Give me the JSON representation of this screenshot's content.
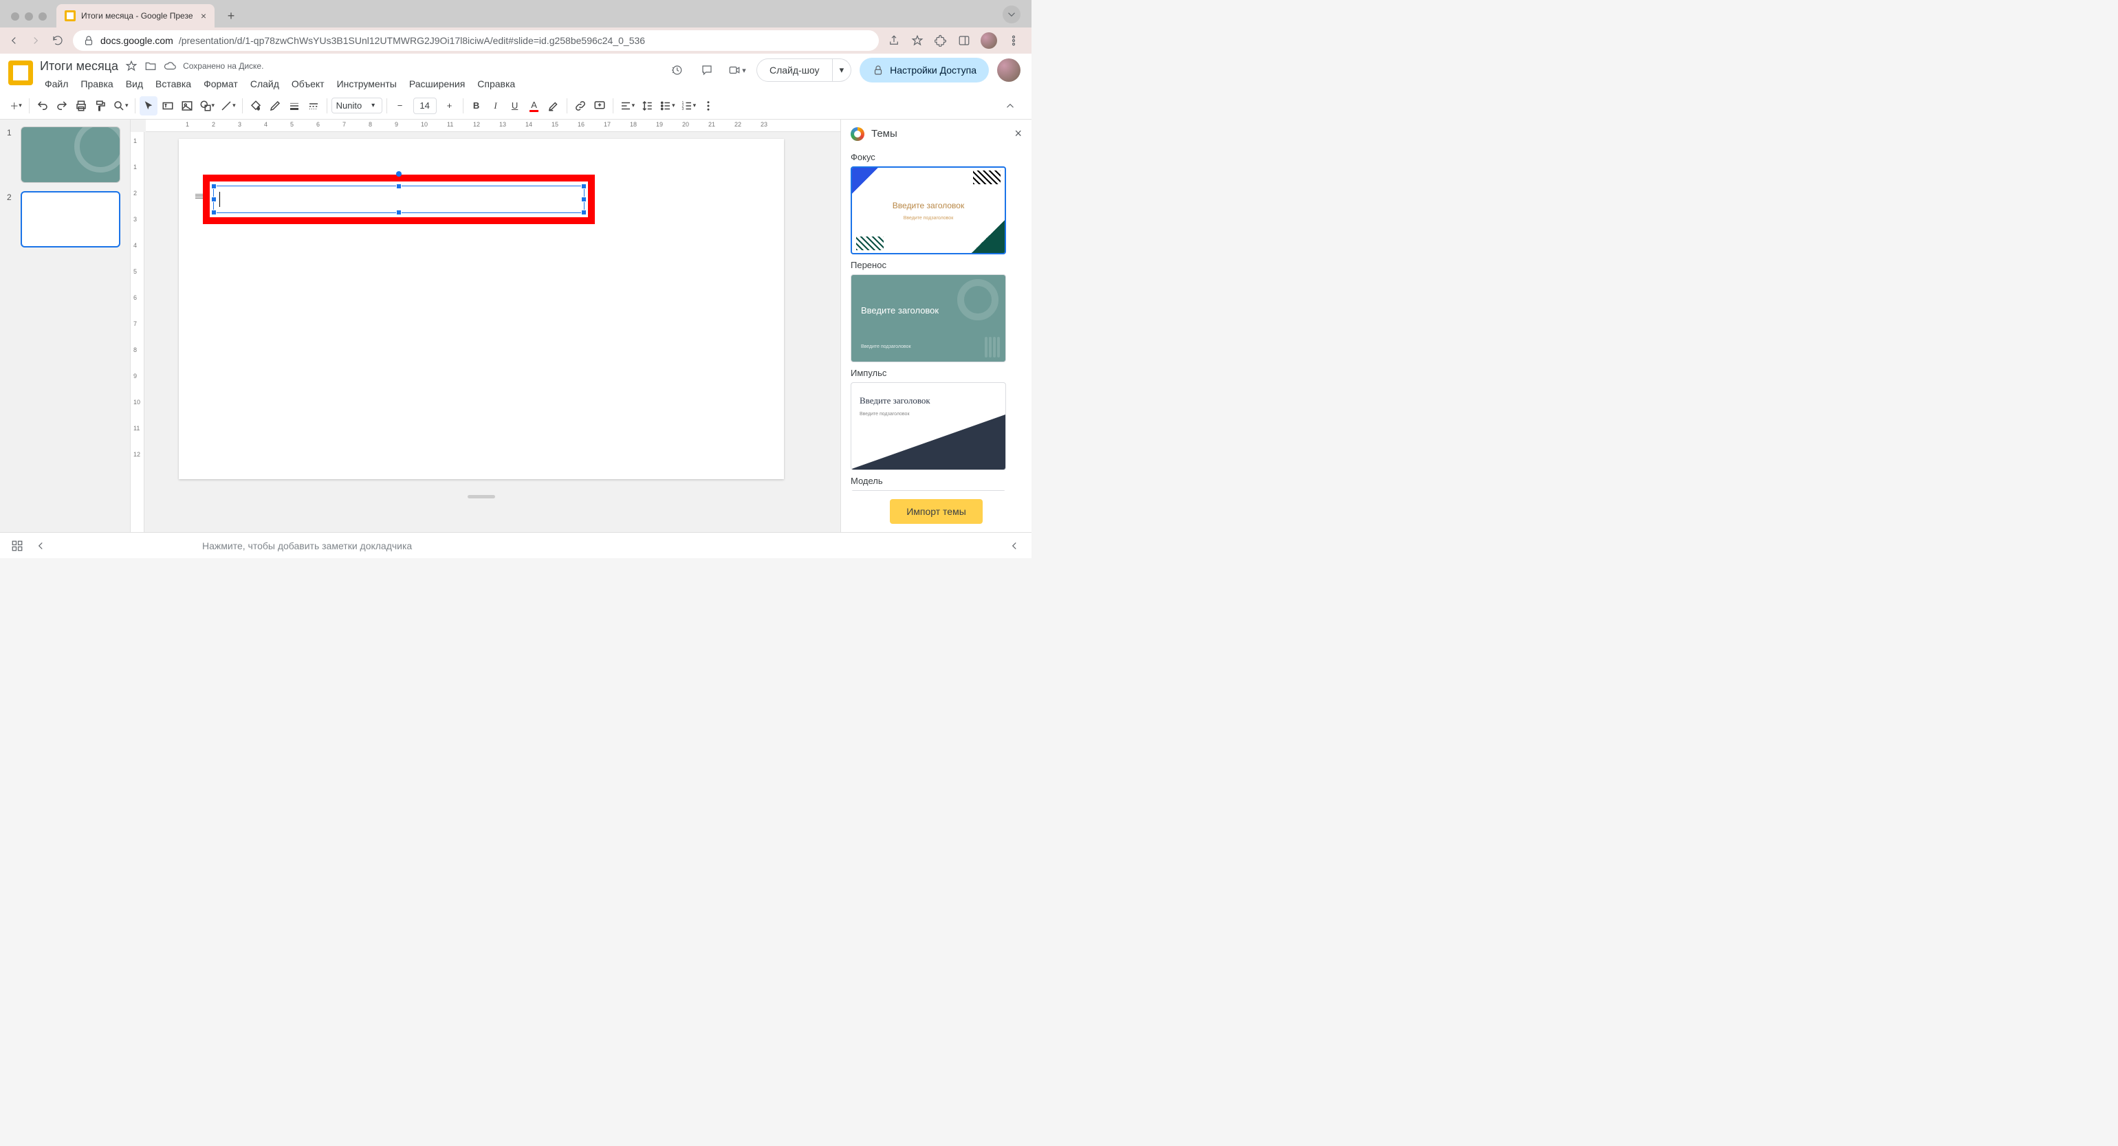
{
  "browser": {
    "tab_title": "Итоги месяца - Google Презе",
    "url_host": "docs.google.com",
    "url_path": "/presentation/d/1-qp78zwChWsYUs3B1SUnl12UTMWRG2J9Oi17l8iciwA/edit#slide=id.g258be596c24_0_536"
  },
  "doc": {
    "title": "Итоги месяца",
    "saved_status": "Сохранено на Диске."
  },
  "menus": [
    "Файл",
    "Правка",
    "Вид",
    "Вставка",
    "Формат",
    "Слайд",
    "Объект",
    "Инструменты",
    "Расширения",
    "Справка"
  ],
  "header_buttons": {
    "slideshow": "Слайд-шоу",
    "share": "Настройки Доступа"
  },
  "toolbar": {
    "font": "Nunito",
    "font_size": "14"
  },
  "slides": [
    {
      "num": "1"
    },
    {
      "num": "2"
    }
  ],
  "ruler_h": [
    "1",
    "2",
    "3",
    "4",
    "5",
    "6",
    "7",
    "8",
    "9",
    "10",
    "11",
    "12",
    "13",
    "14",
    "15",
    "16",
    "17",
    "18",
    "19",
    "20",
    "21",
    "22",
    "23"
  ],
  "ruler_v": [
    "1",
    "1",
    "2",
    "3",
    "4",
    "5",
    "6",
    "7",
    "8",
    "9",
    "10",
    "11",
    "12"
  ],
  "themes_panel": {
    "title": "Темы",
    "items": [
      {
        "name": "Фокус",
        "card_title": "Введите заголовок",
        "card_sub": "Введите подзаголовок"
      },
      {
        "name": "Перенос",
        "card_title": "Введите заголовок",
        "card_sub": "Введите подзаголовок"
      },
      {
        "name": "Импульс",
        "card_title": "Введите заголовок",
        "card_sub": "Введите подзаголовок"
      },
      {
        "name": "Модель",
        "card_title": "",
        "card_sub": ""
      }
    ],
    "import_label": "Импорт темы"
  },
  "notes_placeholder": "Нажмите, чтобы добавить заметки докладчика"
}
